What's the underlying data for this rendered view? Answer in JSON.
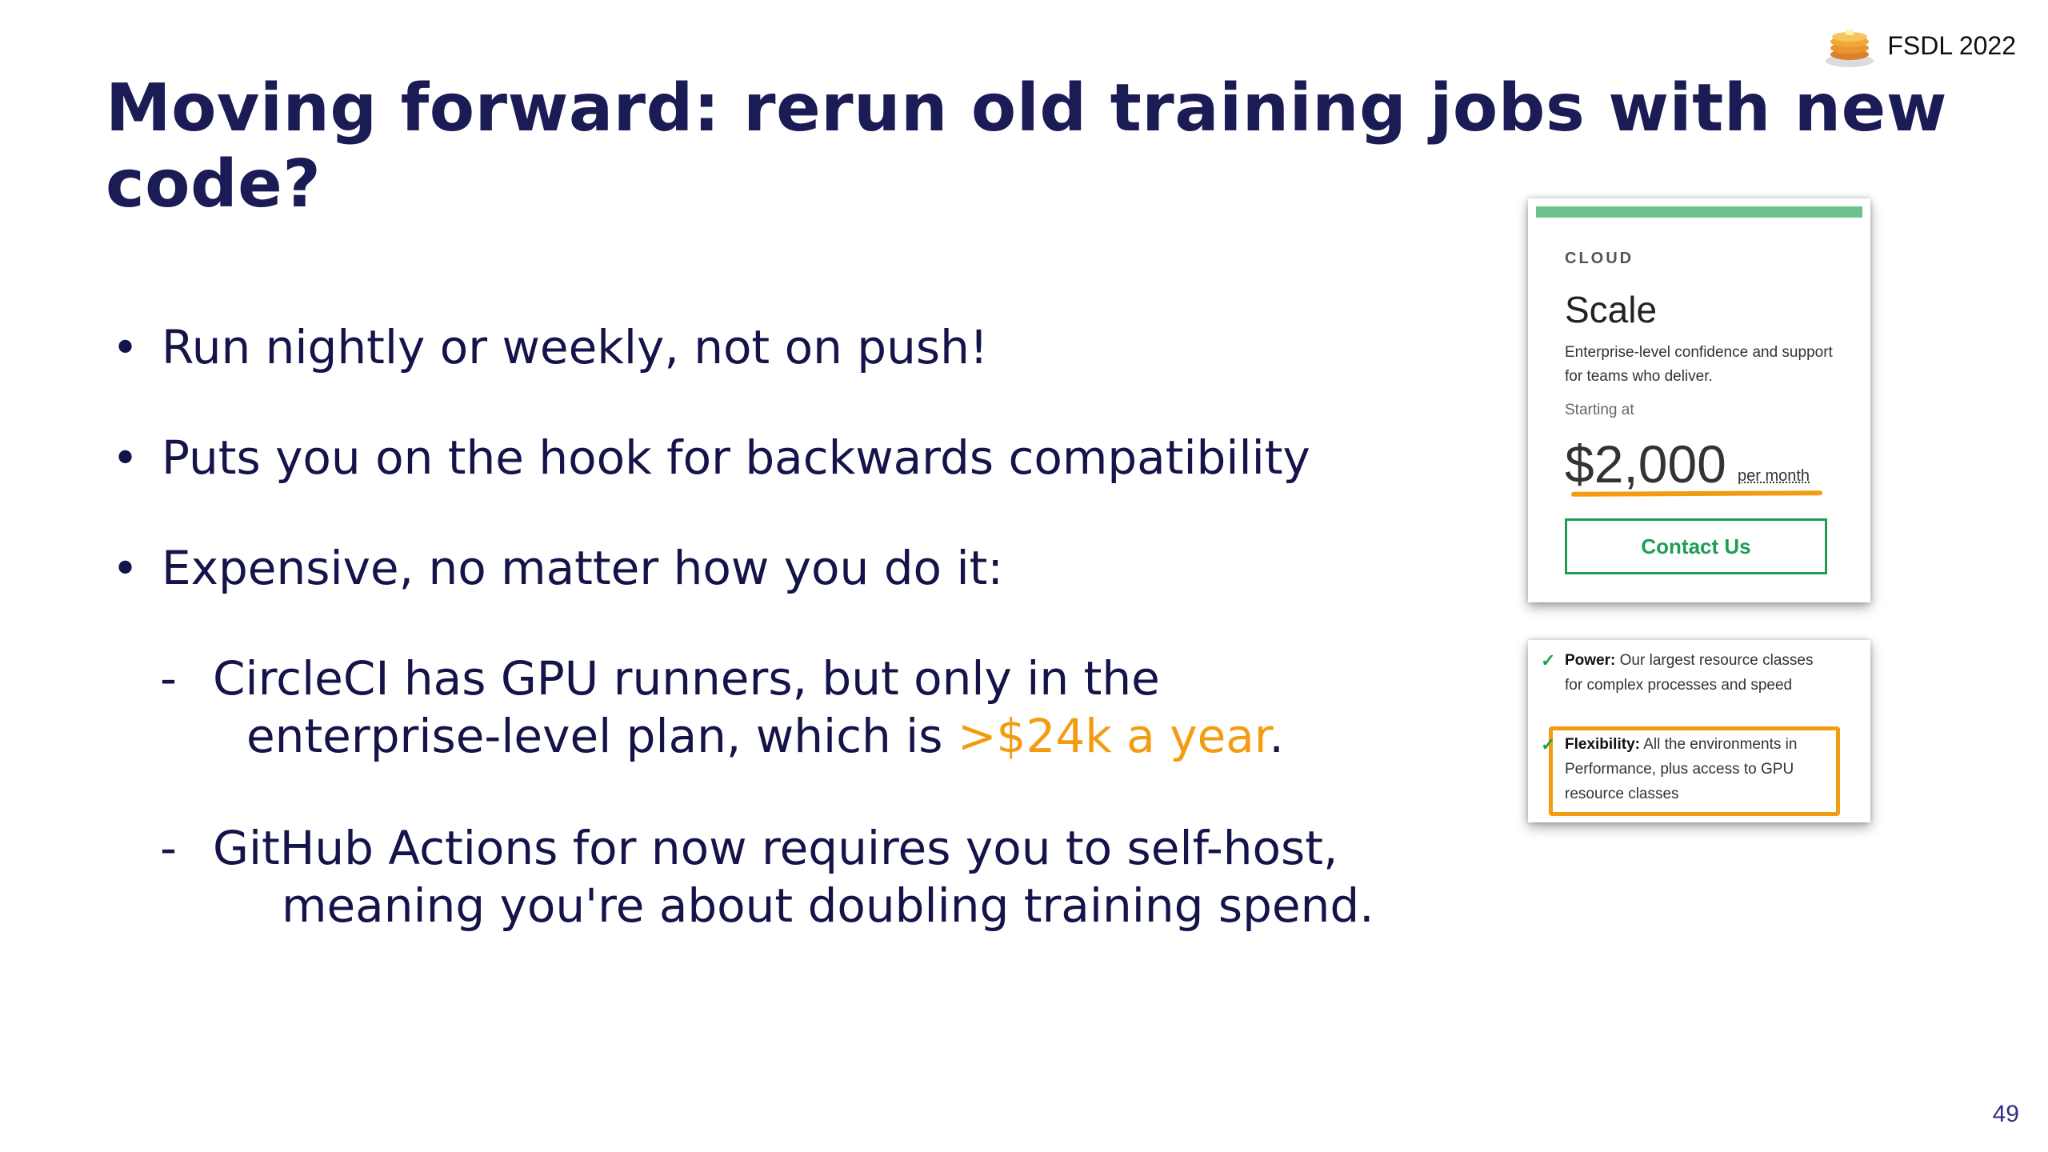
{
  "brand": {
    "label": "FSDL 2022",
    "icon": "pancake-icon"
  },
  "title": "Moving forward: rerun old training jobs with new code?",
  "bullets": [
    "Run nightly or weekly, not on push!",
    "Puts you on the hook for backwards compatibility",
    "Expensive, no matter how you do it:"
  ],
  "subbullets": [
    {
      "marker": "-",
      "line1": "CircleCI has GPU runners, but only in the",
      "line2_pre": "enterprise-level plan, which is ",
      "line2_hl": ">$24k a year",
      "line2_post": "."
    },
    {
      "marker": "-",
      "line1": "GitHub Actions for now requires you to self-host,",
      "line2": "meaning you're about doubling training spend."
    }
  ],
  "pricing_card": {
    "eyebrow": "CLOUD",
    "plan": "Scale",
    "description": "Enterprise-level confidence and support for teams who deliver.",
    "starting_label": "Starting at",
    "price": "$2,000",
    "per": "per month",
    "button": "Contact Us"
  },
  "features": [
    {
      "name": "Power:",
      "text": "Our largest resource classes for complex processes and speed"
    },
    {
      "name": "Flexibility:",
      "text": "All the environments in Performance, plus access to GPU resource classes"
    }
  ],
  "colors": {
    "title": "#1b1b55",
    "highlight": "#f39c12",
    "accent_green": "#1f9d55"
  },
  "page_number": "49"
}
